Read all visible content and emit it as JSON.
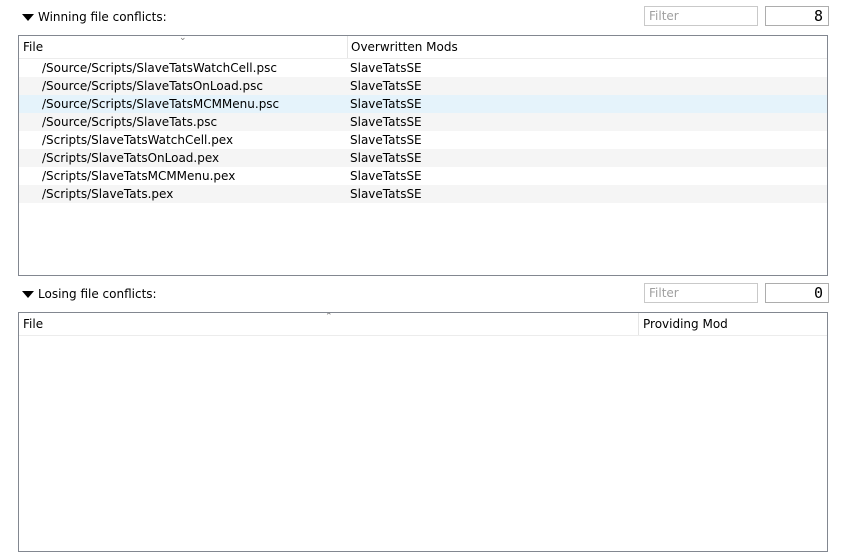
{
  "winning": {
    "title": "Winning file conflicts:",
    "filter_placeholder": "Filter",
    "count": "8",
    "columns": [
      "File",
      "Overwritten Mods"
    ],
    "rows": [
      {
        "file": "/Source/Scripts/SlaveTatsWatchCell.psc",
        "mod": "SlaveTatsSE"
      },
      {
        "file": "/Source/Scripts/SlaveTatsOnLoad.psc",
        "mod": "SlaveTatsSE"
      },
      {
        "file": "/Source/Scripts/SlaveTatsMCMMenu.psc",
        "mod": "SlaveTatsSE"
      },
      {
        "file": "/Source/Scripts/SlaveTats.psc",
        "mod": "SlaveTatsSE"
      },
      {
        "file": "/Scripts/SlaveTatsWatchCell.pex",
        "mod": "SlaveTatsSE"
      },
      {
        "file": "/Scripts/SlaveTatsOnLoad.pex",
        "mod": "SlaveTatsSE"
      },
      {
        "file": "/Scripts/SlaveTatsMCMMenu.pex",
        "mod": "SlaveTatsSE"
      },
      {
        "file": "/Scripts/SlaveTats.pex",
        "mod": "SlaveTatsSE"
      }
    ],
    "selected_row": 2
  },
  "losing": {
    "title": "Losing file conflicts:",
    "filter_placeholder": "Filter",
    "count": "0",
    "columns": [
      "File",
      "Providing Mod"
    ],
    "rows": []
  },
  "icons": {
    "expand": "triangle-down-icon",
    "sort": "sort-caret-up-icon"
  },
  "colors": {
    "selected_row": "#e5f3fb",
    "alt_row": "#f5f5f5",
    "panel_border": "#828790"
  }
}
